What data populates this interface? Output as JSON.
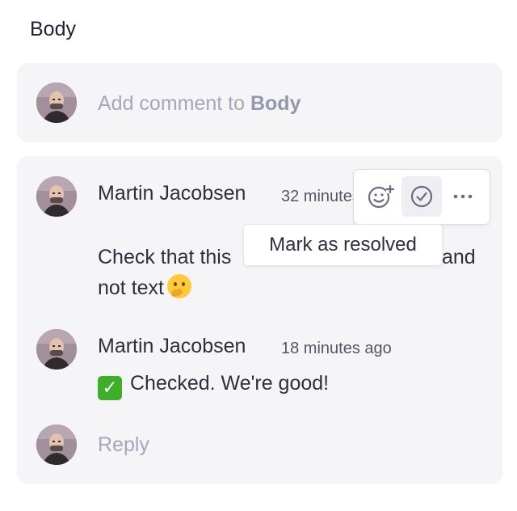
{
  "section": {
    "title": "Body"
  },
  "add_comment": {
    "placeholder_prefix": "Add comment to ",
    "placeholder_target": "Body"
  },
  "comments": [
    {
      "author": "Martin Jacobsen",
      "time": "32 minutes ago",
      "text_line1": "Check that this",
      "text_line1_end": "and",
      "text_line2": "not text",
      "emoji": "thinking-face"
    },
    {
      "author": "Martin Jacobsen",
      "time": "18 minutes ago",
      "text": "Checked. We're good!",
      "emoji": "check-mark-button"
    }
  ],
  "reply": {
    "placeholder": "Reply"
  },
  "toolbar": {
    "add_reaction_icon": "add-reaction-icon",
    "resolve_icon": "check-circle-icon",
    "more_icon": "more-horizontal-icon",
    "tooltip": "Mark as resolved"
  },
  "colors": {
    "panel_bg": "#f5f5f8",
    "placeholder": "#a5a6ba",
    "text": "#2e2f3d"
  }
}
